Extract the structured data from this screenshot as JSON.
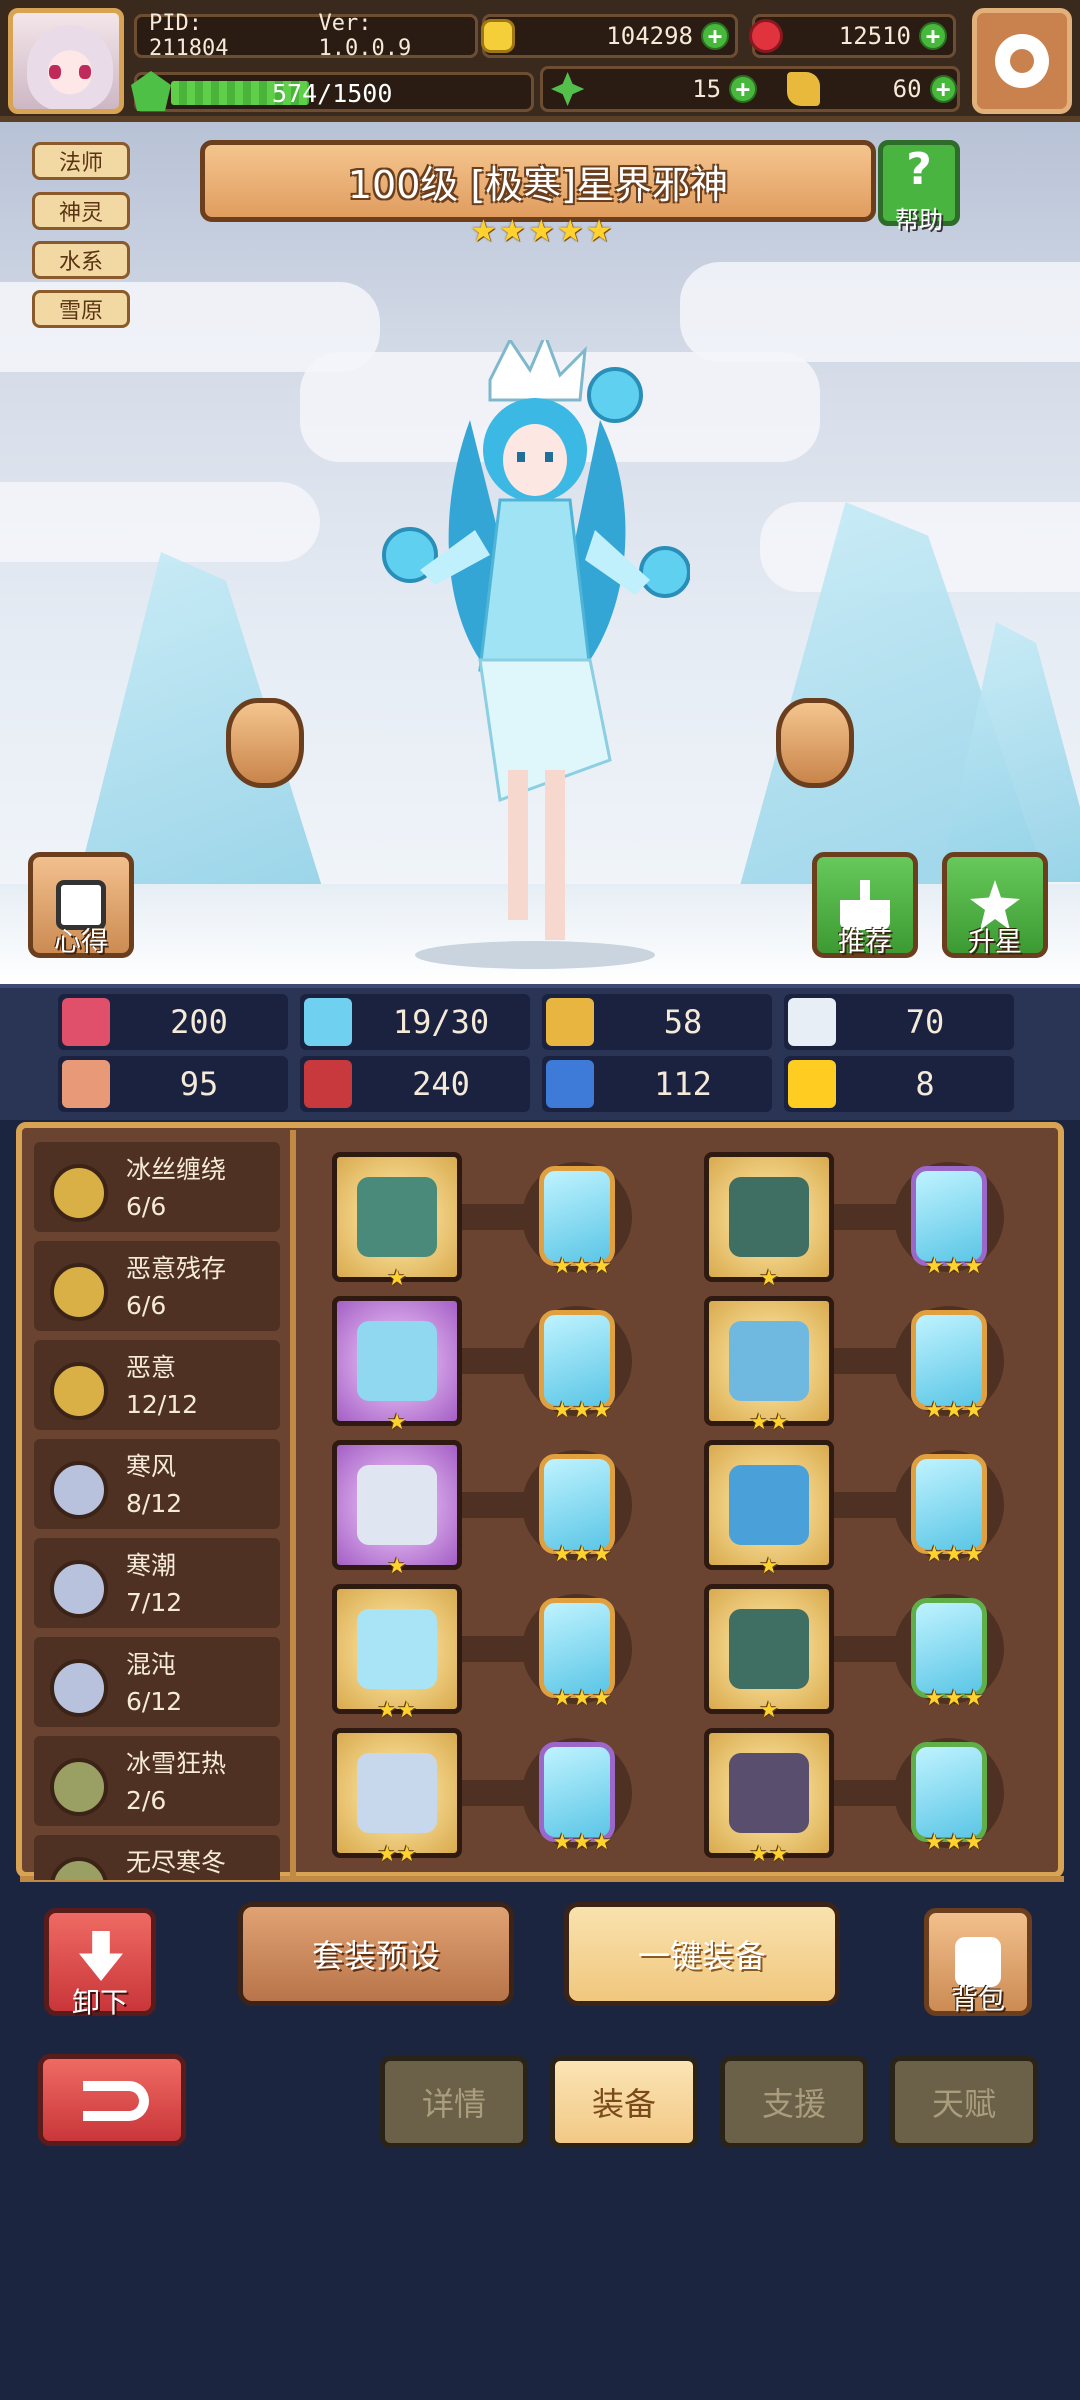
{
  "header": {
    "pid": "PID: 211804",
    "version": "Ver: 1.0.0.9",
    "xp_text": "574/1500",
    "xp_progress": 0.383,
    "gold": "104298",
    "gems": "12510",
    "clover": "15",
    "key": "60"
  },
  "hero": {
    "title": "100级  [极寒]星界邪神",
    "stars": 5,
    "tags": [
      "法师",
      "神灵",
      "水系",
      "雪原"
    ],
    "help_label": "帮助",
    "insight_label": "心得",
    "recommend_label": "推荐",
    "star_up_label": "升星"
  },
  "stats": [
    {
      "icon": "heart-icon",
      "value": "200",
      "color": "#e0506a"
    },
    {
      "icon": "mana-drop-icon",
      "value": "19/30",
      "color": "#6fd0f0"
    },
    {
      "icon": "shield-icon",
      "value": "58",
      "color": "#e8b640"
    },
    {
      "icon": "wing-icon",
      "value": "70",
      "color": "#e8eef6"
    },
    {
      "icon": "fist-icon",
      "value": "95",
      "color": "#e89a78"
    },
    {
      "icon": "spellbook-icon",
      "value": "240",
      "color": "#c8393e"
    },
    {
      "icon": "scroll-icon",
      "value": "112",
      "color": "#3e7ad8"
    },
    {
      "icon": "horseshoe-icon",
      "value": "8",
      "color": "#ffcc22"
    }
  ],
  "sets": [
    {
      "name": "冰丝缠绕",
      "count": "6/6",
      "color": "#d8b046"
    },
    {
      "name": "恶意残存",
      "count": "6/6",
      "color": "#d8b046"
    },
    {
      "name": "恶意",
      "count": "12/12",
      "color": "#d8b046"
    },
    {
      "name": "寒风",
      "count": "8/12",
      "color": "#b8c2dc"
    },
    {
      "name": "寒潮",
      "count": "7/12",
      "color": "#b8c2dc"
    },
    {
      "name": "混沌",
      "count": "6/12",
      "color": "#b8c2dc"
    },
    {
      "name": "冰雪狂热",
      "count": "2/6",
      "color": "#9aa064"
    },
    {
      "name": "无尽寒冬",
      "count": "",
      "color": "#9aa064"
    }
  ],
  "equipment": [
    {
      "item": "staff-icon",
      "frame": "gold",
      "item_stars": "★",
      "gem": "orange",
      "gem_stars": "★★★"
    },
    {
      "item": "armor-icon",
      "frame": "gold",
      "item_stars": "★",
      "gem": "purple",
      "gem_stars": "★★★"
    },
    {
      "item": "orb-icon",
      "frame": "purple",
      "item_stars": "★",
      "gem": "orange",
      "gem_stars": "★★★"
    },
    {
      "item": "cape-icon",
      "frame": "gold",
      "item_stars": "★★",
      "gem": "orange",
      "gem_stars": "★★★"
    },
    {
      "item": "necklace-icon",
      "frame": "purple",
      "item_stars": "★",
      "gem": "orange",
      "gem_stars": "★★★"
    },
    {
      "item": "glove-icon",
      "frame": "gold",
      "item_stars": "★",
      "gem": "orange",
      "gem_stars": "★★★"
    },
    {
      "item": "crystal-icon",
      "frame": "gold",
      "item_stars": "★★",
      "gem": "orange",
      "gem_stars": "★★★"
    },
    {
      "item": "belt-icon",
      "frame": "gold",
      "item_stars": "★",
      "gem": "green",
      "gem_stars": "★★★"
    },
    {
      "item": "ring-icon",
      "frame": "gold",
      "item_stars": "★★",
      "gem": "purple",
      "gem_stars": "★★★"
    },
    {
      "item": "boots-icon",
      "frame": "gold",
      "item_stars": "★★",
      "gem": "green",
      "gem_stars": "★★★"
    }
  ],
  "actions": {
    "unequip": "卸下",
    "preset": "套装预设",
    "equip_all": "一键装备",
    "bag": "背包"
  },
  "tabs": [
    {
      "label": "详情",
      "active": false
    },
    {
      "label": "装备",
      "active": true
    },
    {
      "label": "支援",
      "active": false
    },
    {
      "label": "天赋",
      "active": false
    }
  ]
}
